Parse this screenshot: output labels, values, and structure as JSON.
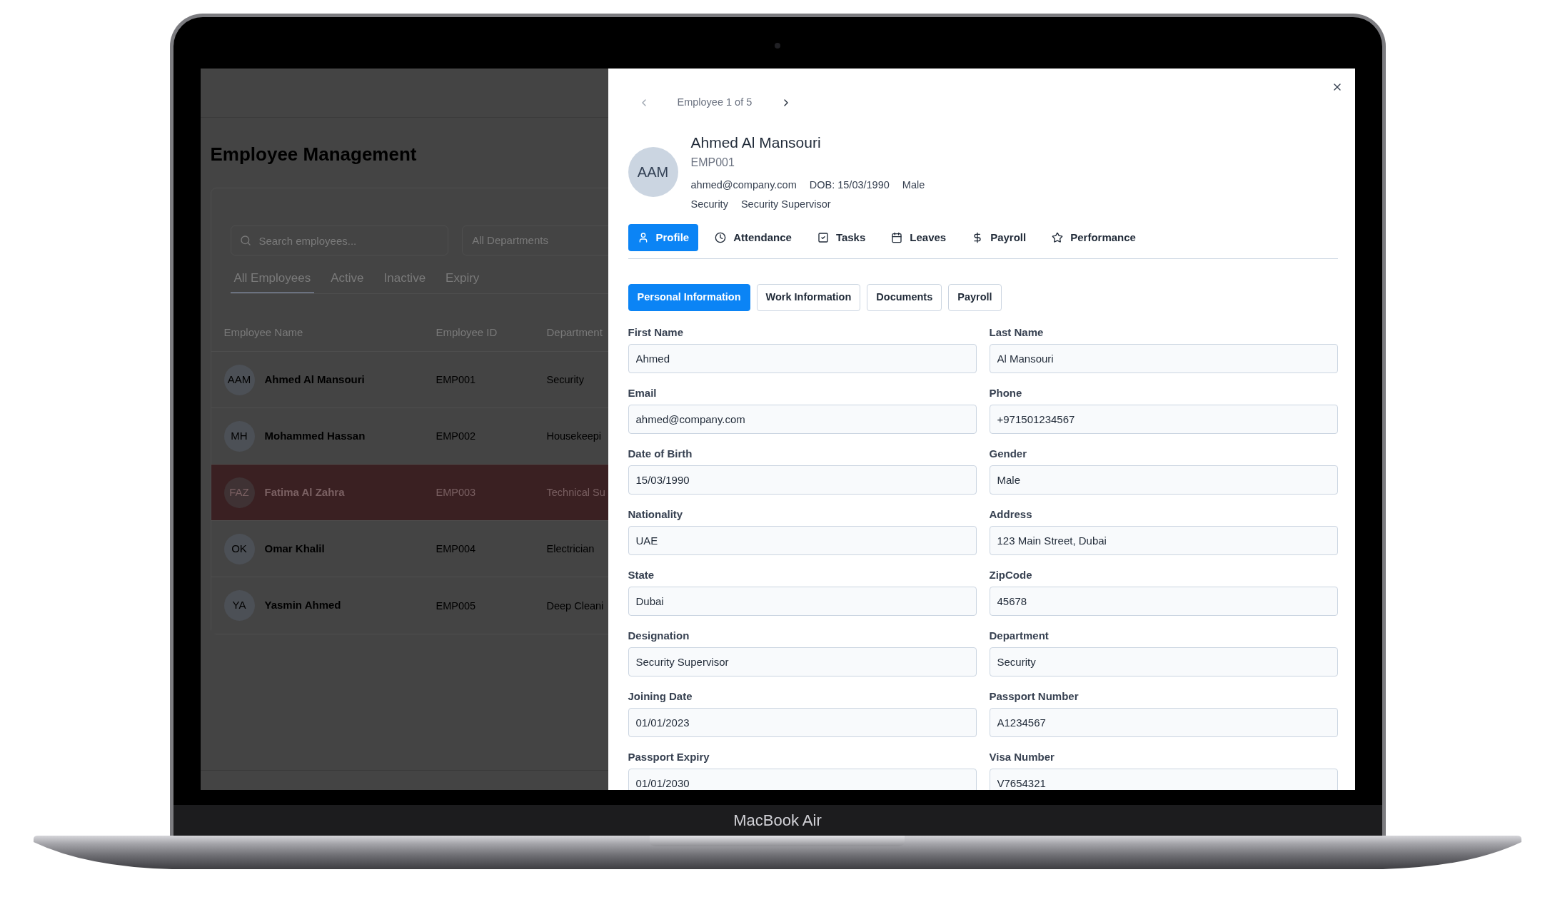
{
  "device": {
    "label": "MacBook Air"
  },
  "background_page": {
    "title": "Employee Management",
    "search": {
      "placeholder": "Search employees..."
    },
    "department_filter": {
      "value": "All Departments"
    },
    "tabs": [
      {
        "label": "All Employees",
        "selected": true
      },
      {
        "label": "Active",
        "selected": false
      },
      {
        "label": "Inactive",
        "selected": false
      },
      {
        "label": "Expiry",
        "selected": false
      }
    ],
    "table": {
      "columns": [
        "Employee Name",
        "Employee ID",
        "Department"
      ],
      "rows": [
        {
          "initials": "AAM",
          "name": "Ahmed Al Mansouri",
          "employee_id": "EMP001",
          "department": "Security",
          "highlighted": false
        },
        {
          "initials": "MH",
          "name": "Mohammed Hassan",
          "employee_id": "EMP002",
          "department": "Housekeepi",
          "highlighted": false
        },
        {
          "initials": "FAZ",
          "name": "Fatima Al Zahra",
          "employee_id": "EMP003",
          "department": "Technical Su",
          "highlighted": true
        },
        {
          "initials": "OK",
          "name": "Omar Khalil",
          "employee_id": "EMP004",
          "department": "Electrician",
          "highlighted": false
        },
        {
          "initials": "YA",
          "name": "Yasmin Ahmed",
          "employee_id": "EMP005",
          "department": "Deep Cleani",
          "highlighted": false
        }
      ]
    }
  },
  "drawer": {
    "navigation": {
      "previous": {
        "disabled": true
      },
      "counter": "Employee 1 of 5",
      "next": {
        "disabled": false
      }
    },
    "profile": {
      "initials": "AAM",
      "name": "Ahmed Al Mansouri",
      "employee_id": "EMP001",
      "details": [
        "ahmed@company.com",
        "DOB: 15/03/1990",
        "Male"
      ],
      "tags": [
        "Security",
        "Security Supervisor"
      ]
    },
    "tabs": [
      {
        "label": "Profile",
        "selected": true
      },
      {
        "label": "Attendance",
        "selected": false
      },
      {
        "label": "Tasks",
        "selected": false
      },
      {
        "label": "Leaves",
        "selected": false
      },
      {
        "label": "Payroll",
        "selected": false
      },
      {
        "label": "Performance",
        "selected": false
      }
    ],
    "sections": [
      {
        "label": "Personal Information",
        "selected": true
      },
      {
        "label": "Work Information",
        "selected": false
      },
      {
        "label": "Documents",
        "selected": false
      },
      {
        "label": "Payroll",
        "selected": false
      }
    ],
    "fields": [
      {
        "label": "First Name",
        "value": "Ahmed"
      },
      {
        "label": "Last Name",
        "value": "Al Mansouri"
      },
      {
        "label": "Email",
        "value": "ahmed@company.com"
      },
      {
        "label": "Phone",
        "value": "+971501234567"
      },
      {
        "label": "Date of Birth",
        "value": "15/03/1990"
      },
      {
        "label": "Gender",
        "value": "Male"
      },
      {
        "label": "Nationality",
        "value": "UAE"
      },
      {
        "label": "Address",
        "value": "123 Main Street, Dubai"
      },
      {
        "label": "State",
        "value": "Dubai"
      },
      {
        "label": "ZipCode",
        "value": "45678"
      },
      {
        "label": "Designation",
        "value": "Security Supervisor"
      },
      {
        "label": "Department",
        "value": "Security"
      },
      {
        "label": "Joining Date",
        "value": "01/01/2023"
      },
      {
        "label": "Passport Number",
        "value": "A1234567"
      },
      {
        "label": "Passport Expiry",
        "value": "01/01/2030"
      },
      {
        "label": "Visa Number",
        "value": "V7654321"
      }
    ]
  }
}
